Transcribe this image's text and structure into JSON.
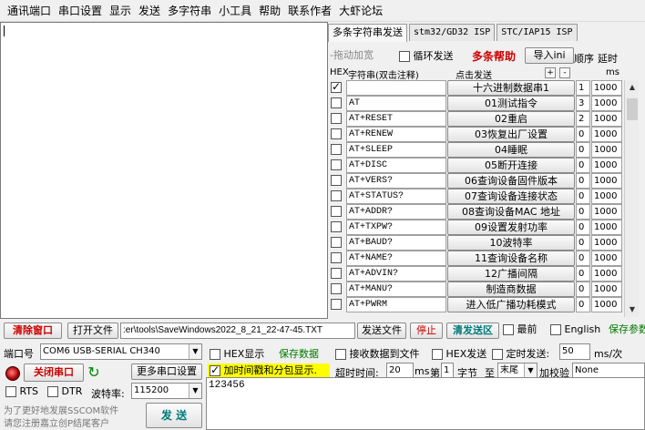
{
  "menu": [
    "通讯端口",
    "串口设置",
    "显示",
    "发送",
    "多字符串",
    "小工具",
    "帮助",
    "联系作者",
    "大虾论坛"
  ],
  "tabs": [
    "多条字符串发送",
    "stm32/GD32 ISP",
    "STC/IAP15 ISP"
  ],
  "toolbar": {
    "drag_label": "-拖动加宽",
    "loop_label": "循环发送",
    "help_label": "多条帮助",
    "import_label": "导入ini",
    "order_label": "顺序",
    "delay_label": "延时"
  },
  "header": {
    "hex": "HEX",
    "string_col": "字符串(双击注释)",
    "send_col": "点击发送",
    "plus": "+",
    "minus": "-",
    "ms": "ms"
  },
  "rows": [
    {
      "checked": true,
      "cmd": "",
      "btn": "十六进制数据串1",
      "order": "1",
      "delay": "1000"
    },
    {
      "checked": false,
      "cmd": "AT",
      "btn": "01测试指令",
      "order": "3",
      "delay": "1000"
    },
    {
      "checked": false,
      "cmd": "AT+RESET",
      "btn": "02重启",
      "order": "2",
      "delay": "1000"
    },
    {
      "checked": false,
      "cmd": "AT+RENEW",
      "btn": "03恢复出厂设置",
      "order": "0",
      "delay": "1000"
    },
    {
      "checked": false,
      "cmd": "AT+SLEEP",
      "btn": "04睡眠",
      "order": "0",
      "delay": "1000"
    },
    {
      "checked": false,
      "cmd": "AT+DISC",
      "btn": "05断开连接",
      "order": "0",
      "delay": "1000"
    },
    {
      "checked": false,
      "cmd": "AT+VERS?",
      "btn": "06查询设备固件版本",
      "order": "0",
      "delay": "1000"
    },
    {
      "checked": false,
      "cmd": "AT+STATUS?",
      "btn": "07查询设备连接状态",
      "order": "0",
      "delay": "1000"
    },
    {
      "checked": false,
      "cmd": "AT+ADDR?",
      "btn": "08查询设备MAC 地址",
      "order": "0",
      "delay": "1000"
    },
    {
      "checked": false,
      "cmd": "AT+TXPW?",
      "btn": "09设置发射功率",
      "order": "0",
      "delay": "1000"
    },
    {
      "checked": false,
      "cmd": "AT+BAUD?",
      "btn": "10波特率",
      "order": "0",
      "delay": "1000"
    },
    {
      "checked": false,
      "cmd": "AT+NAME?",
      "btn": "11查询设备名称",
      "order": "0",
      "delay": "1000"
    },
    {
      "checked": false,
      "cmd": "AT+ADVIN?",
      "btn": "12广播间隔",
      "order": "0",
      "delay": "1000"
    },
    {
      "checked": false,
      "cmd": "AT+MANU?",
      "btn": "制造商数据",
      "order": "0",
      "delay": "1000"
    },
    {
      "checked": false,
      "cmd": "AT+PWRM",
      "btn": "进入低广播功耗模式",
      "order": "0",
      "delay": "1000"
    }
  ],
  "bottom": {
    "clear_window": "清除窗口",
    "open_file": "打开文件",
    "file_path": ":er\\tools\\SaveWindows2022_8_21_22-47-45.TXT",
    "send_file": "发送文件",
    "stop": "停止",
    "clear_send": "清发送区",
    "topmost": "最前",
    "english": "English",
    "save_params": "保存参数"
  },
  "port": {
    "port_label": "端口号",
    "port_value": "COM6 USB-SERIAL CH340",
    "close_port": "关闭串口",
    "more_settings": "更多串口设置",
    "rts": "RTS",
    "dtr": "DTR",
    "baud_label": "波特率:",
    "baud_value": "115200",
    "promo1": "为了更好地发展SSCOM软件",
    "promo2": "请您注册嘉立创P结尾客户",
    "send": "发 送"
  },
  "options": {
    "hex_display": "HEX显示",
    "save_data": "保存数据",
    "recv_to_file": "接收数据到文件",
    "hex_send": "HEX发送",
    "timed_send": "定时发送:",
    "interval": "50",
    "interval_unit": "ms/次",
    "timestamp": "加时间戳和分包显示.",
    "timeout_label": "超时时间:",
    "timeout_value": "20",
    "timeout_unit": "ms",
    "nth_label": "第",
    "nth_value": "1",
    "byte_label": "字节",
    "to_label": "至",
    "to_value": "末尾",
    "checksum_label": "加校验",
    "checksum_value": "None"
  },
  "send_content": "123456"
}
